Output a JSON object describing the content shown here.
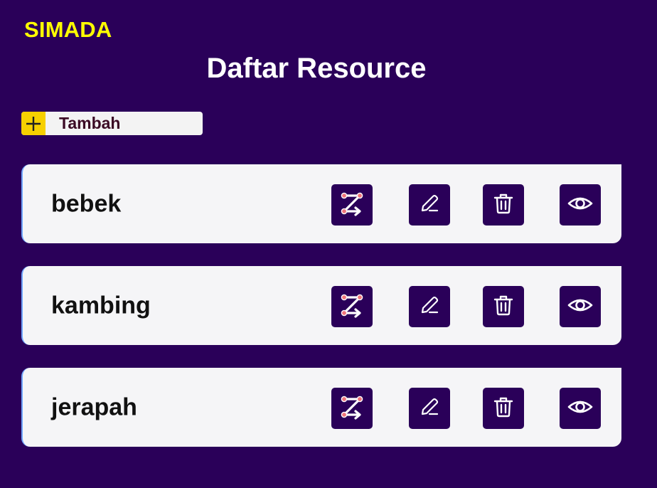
{
  "app": {
    "brand": "SIMADA",
    "title": "Daftar Resource"
  },
  "toolbar": {
    "add_label": "Tambah",
    "add_icon": "plus-icon"
  },
  "colors": {
    "background": "#2a0059",
    "brand": "#ffff00",
    "add_icon_bg": "#f7d000",
    "card_bg": "#f5f5f7",
    "action_bg": "#2a0059"
  },
  "resources": [
    {
      "name": "bebek"
    },
    {
      "name": "kambing"
    },
    {
      "name": "jerapah"
    }
  ],
  "actions": [
    "flow-icon",
    "edit-icon",
    "delete-icon",
    "view-icon"
  ]
}
